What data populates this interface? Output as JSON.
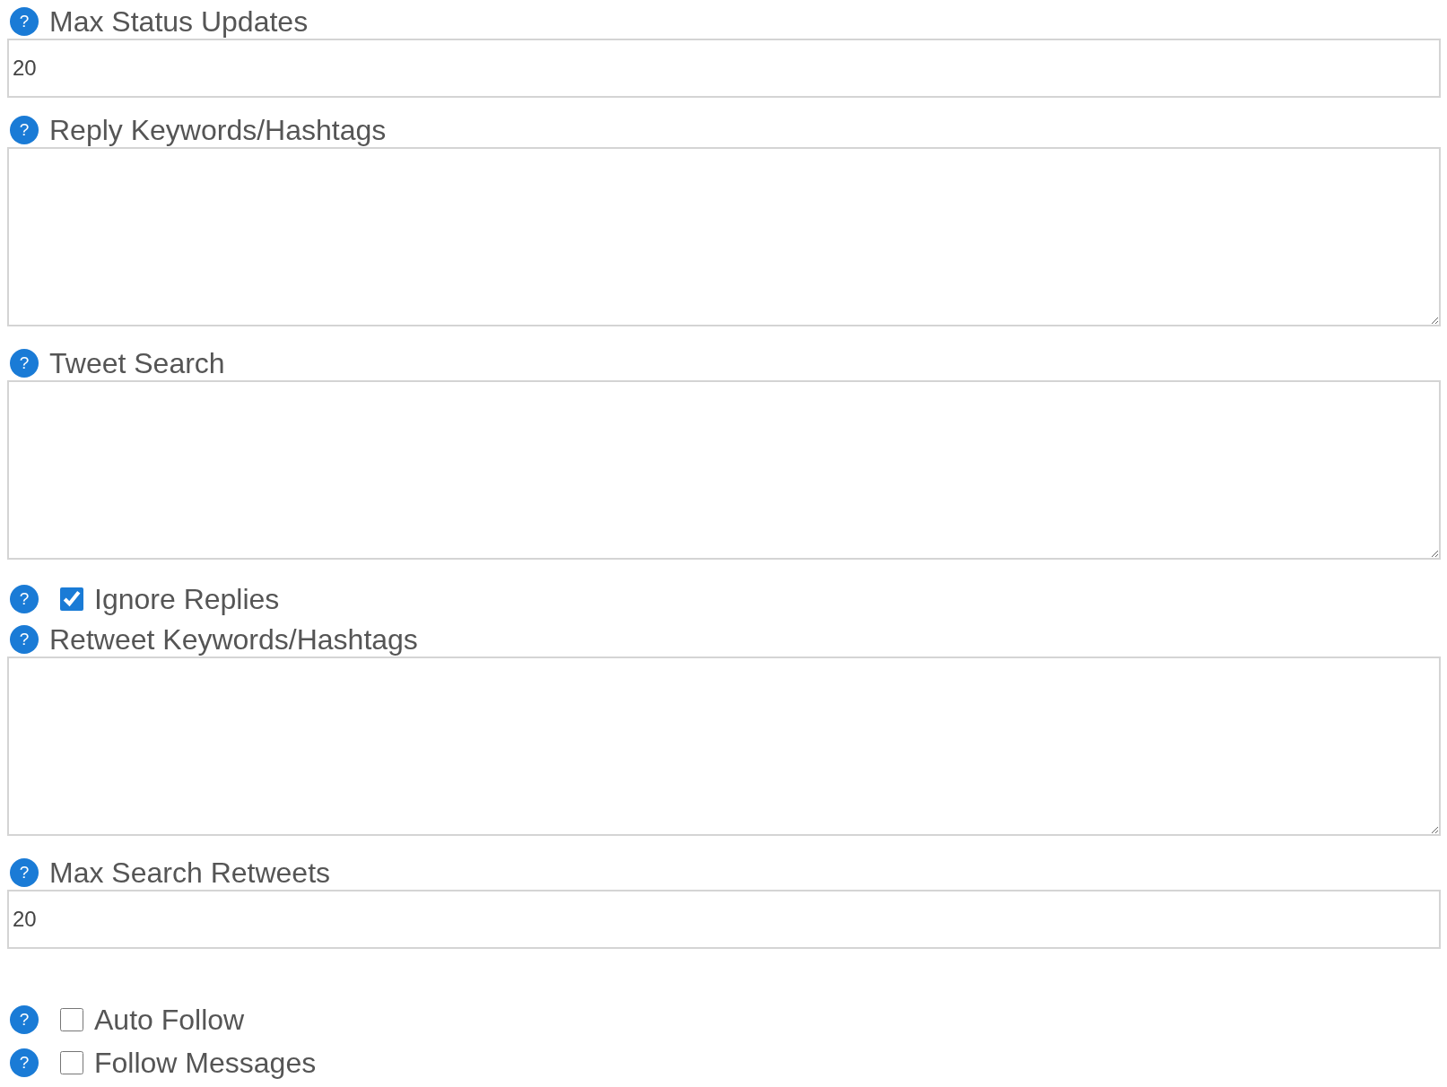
{
  "settings": [
    {
      "kind": "input",
      "help": "?",
      "label": "Max Status Updates",
      "value": "20"
    },
    {
      "kind": "textarea",
      "help": "?",
      "label": "Reply Keywords/Hashtags"
    },
    {
      "kind": "textarea",
      "help": "?",
      "label": "Tweet Search"
    },
    {
      "kind": "checkbox",
      "help": "?",
      "label": "Ignore Replies",
      "checked": true
    },
    {
      "kind": "textarea",
      "help": "?",
      "label": "Retweet Keywords/Hashtags"
    },
    {
      "kind": "input",
      "help": "?",
      "label": "Max Search Retweets",
      "value": "20"
    },
    {
      "kind": "spacer"
    },
    {
      "kind": "checkbox",
      "help": "?",
      "label": "Auto Follow",
      "checked": false
    },
    {
      "kind": "checkbox",
      "help": "?",
      "label": "Follow Messages",
      "checked": false
    }
  ]
}
